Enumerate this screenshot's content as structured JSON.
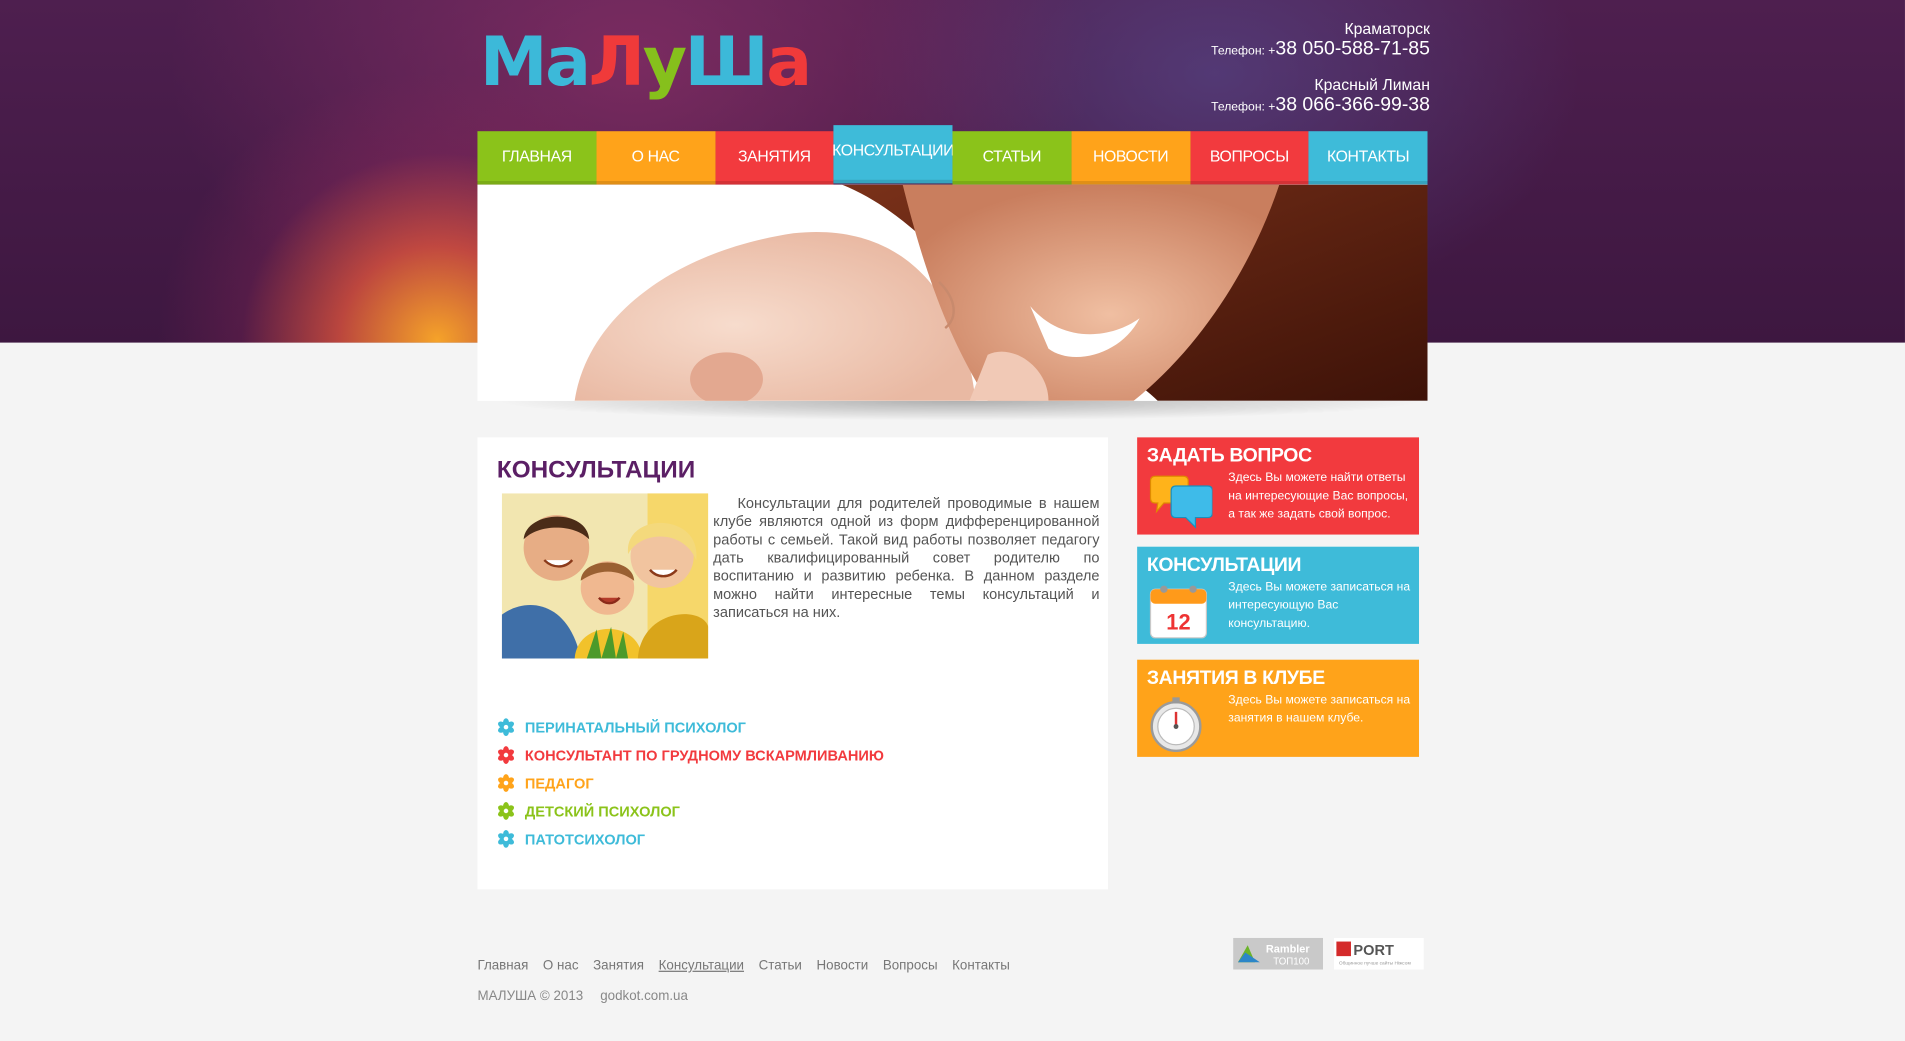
{
  "logo": {
    "letters": [
      {
        "ch": "М",
        "color": "#3cb9d9"
      },
      {
        "ch": "а",
        "color": "#3cb9d9"
      },
      {
        "ch": "Л",
        "color": "#f03a3a"
      },
      {
        "ch": "у",
        "color": "#86c01c"
      },
      {
        "ch": "Ш",
        "color": "#3cb9d9"
      },
      {
        "ch": "а",
        "color": "#f03a3a"
      }
    ]
  },
  "contacts": [
    {
      "city": "Краматорск",
      "label": "Телефон: +",
      "phone": "38 050-588-71-85"
    },
    {
      "city": "Красный Лиман",
      "label": "Телефон: +",
      "phone": "38 066-366-99-38"
    }
  ],
  "nav": [
    {
      "label": "ГЛАВНАЯ",
      "color": "#8bc31a",
      "active": false
    },
    {
      "label": "О НАС",
      "color": "#ffa31a",
      "active": false
    },
    {
      "label": "ЗАНЯТИЯ",
      "color": "#f23a3e",
      "active": false
    },
    {
      "label": "КОНСУЛЬТАЦИИ",
      "color": "#3ebbd9",
      "active": true
    },
    {
      "label": "СТАТЬИ",
      "color": "#8bc31a",
      "active": false
    },
    {
      "label": "НОВОСТИ",
      "color": "#ffa31a",
      "active": false
    },
    {
      "label": "ВОПРОСЫ",
      "color": "#f23a3e",
      "active": false
    },
    {
      "label": "КОНТАКТЫ",
      "color": "#3ebbd9",
      "active": false
    }
  ],
  "content": {
    "title": "КОНСУЛЬТАЦИИ",
    "intro": "Консультации для родителей проводимые в нашем клубе являются одной из форм дифференцированной работы с семьей. Такой вид работы позволяет педагогу дать квалифицированный совет родителю по воспитанию и развитию ребенка. В данном разделе можно найти интересные темы консультаций и записаться на них.",
    "links": [
      {
        "label": "ПЕРИНАТАЛЬНЫЙ ПСИХОЛОГ",
        "color": "#3ebbd9"
      },
      {
        "label": "КОНСУЛЬТАНТ ПО ГРУДНОМУ ВСКАРМЛИВАНИЮ",
        "color": "#f23a3e"
      },
      {
        "label": "ПЕДАГОГ",
        "color": "#ffa31a"
      },
      {
        "label": "ДЕТСКИЙ ПСИХОЛОГ",
        "color": "#8bc31a"
      },
      {
        "label": "ПАТОТСИХОЛОГ",
        "color": "#3ebbd9"
      }
    ]
  },
  "sidebar": {
    "ask": {
      "title": "ЗАДАТЬ ВОПРОС",
      "text": "Здесь Вы можете найти ответы на интересующие Вас вопросы, а так же задать свой вопрос.",
      "color": "#f23a3e"
    },
    "consult": {
      "title": "КОНСУЛЬТАЦИИ",
      "text": "Здесь Вы можете записаться на интересующую Вас консультацию.",
      "color": "#3ebbd9",
      "calendar_day": "12"
    },
    "club": {
      "title": "ЗАНЯТИЯ В КЛУБЕ",
      "text": "Здесь Вы можете записаться на занятия в нашем клубе.",
      "color": "#ffa31a"
    }
  },
  "footer": {
    "nav": [
      "Главная",
      "О нас",
      "Занятия",
      "Консультации",
      "Статьи",
      "Новости",
      "Вопросы",
      "Контакты"
    ],
    "active_index": 3,
    "copyright": "МАЛУША © 2013",
    "credit": "godkot.com.ua",
    "rambler": {
      "name": "Rambler",
      "sub": "ТОП100"
    },
    "port": {
      "name": "PORT",
      "sub": "Общинное пучше сайты Ніжсом"
    }
  }
}
